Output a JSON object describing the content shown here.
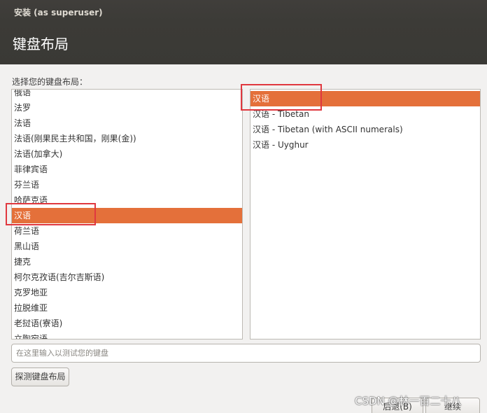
{
  "window": {
    "title": "安装 (as superuser)"
  },
  "page": {
    "heading": "键盘布局",
    "prompt": "选择您的键盘布局："
  },
  "layouts": {
    "items": [
      {
        "label": "俄语"
      },
      {
        "label": "法罗"
      },
      {
        "label": "法语"
      },
      {
        "label": "法语(刚果民主共和国，刚果(金))"
      },
      {
        "label": "法语(加拿大)"
      },
      {
        "label": "菲律宾语"
      },
      {
        "label": "芬兰语"
      },
      {
        "label": "哈萨克语"
      },
      {
        "label": "汉语",
        "selected": true
      },
      {
        "label": "荷兰语"
      },
      {
        "label": "黑山语"
      },
      {
        "label": "捷克"
      },
      {
        "label": "柯尔克孜语(吉尔吉斯语)"
      },
      {
        "label": "克罗地亚"
      },
      {
        "label": "拉脱维亚"
      },
      {
        "label": "老挝语(寮语)"
      },
      {
        "label": "立陶宛语"
      }
    ]
  },
  "variants": {
    "items": [
      {
        "label": "汉语",
        "selected": true
      },
      {
        "label": "汉语 - Tibetan"
      },
      {
        "label": "汉语 - Tibetan (with ASCII numerals)"
      },
      {
        "label": "汉语 - Uyghur"
      }
    ]
  },
  "test_input": {
    "placeholder": "在这里输入以测试您的键盘",
    "value": ""
  },
  "buttons": {
    "detect": "探测键盘布局",
    "back": "后退(B)",
    "next": "继续"
  },
  "watermark": "CSDN @林一百二十八",
  "colors": {
    "selection": "#e4703a",
    "highlight_box": "#e0383f",
    "titlebar": "#3c3b37"
  }
}
